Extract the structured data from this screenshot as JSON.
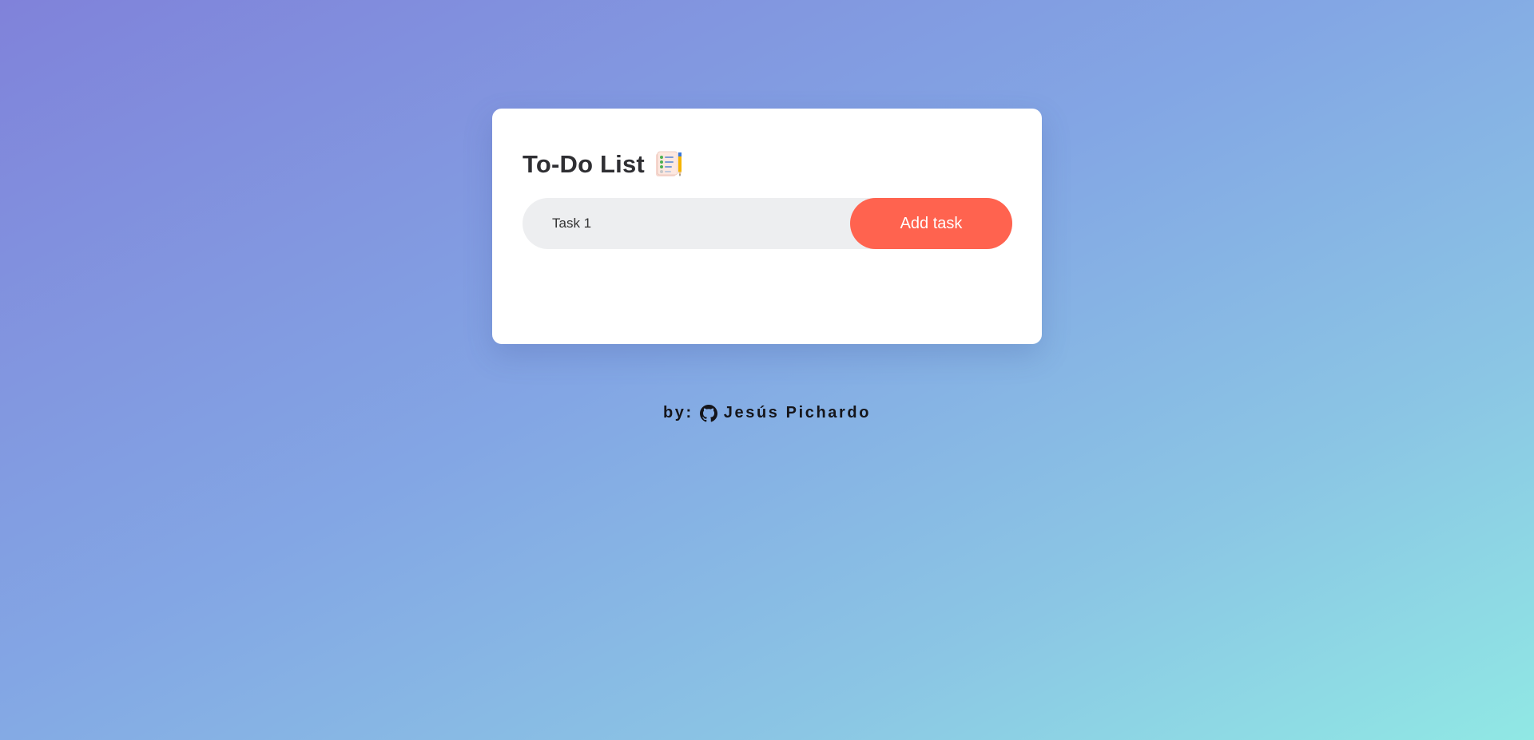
{
  "app": {
    "title": "To-Do List",
    "title_icon": "clipboard-checklist-icon"
  },
  "form": {
    "input_value": "Task 1",
    "add_button_label": "Add task"
  },
  "task_list": [],
  "footer": {
    "prefix": "by:",
    "icon": "github-icon",
    "author": "Jesús Pichardo"
  },
  "colors": {
    "accent": "#ff634f",
    "input_bg": "#edeef0",
    "card_bg": "#ffffff",
    "title_text": "#2f2f33",
    "gradient_start": "#8082da",
    "gradient_end": "#90e8e4"
  }
}
